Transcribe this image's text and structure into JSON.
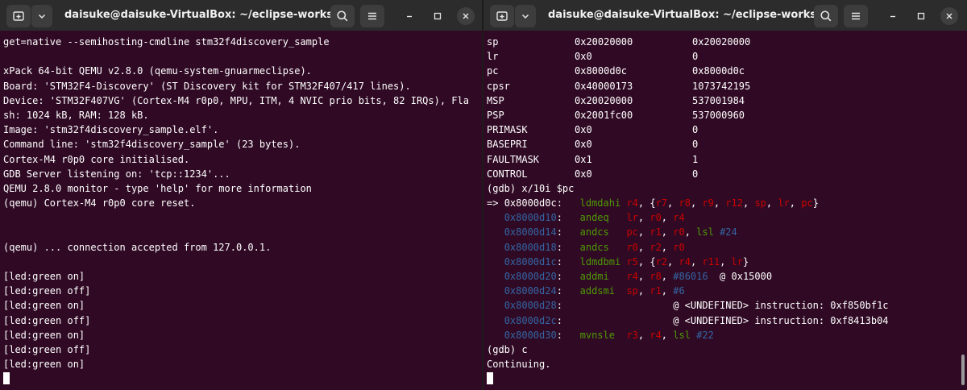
{
  "left_window": {
    "title": "daisuke@daisuke-VirtualBox: ~/eclipse-works...",
    "lines": [
      "get=native --semihosting-cmdline stm32f4discovery_sample",
      "",
      "xPack 64-bit QEMU v2.8.0 (qemu-system-gnuarmeclipse).",
      "Board: 'STM32F4-Discovery' (ST Discovery kit for STM32F407/417 lines).",
      "Device: 'STM32F407VG' (Cortex-M4 r0p0, MPU, ITM, 4 NVIC prio bits, 82 IRQs), Fla",
      "sh: 1024 kB, RAM: 128 kB.",
      "Image: 'stm32f4discovery_sample.elf'.",
      "Command line: 'stm32f4discovery_sample' (23 bytes).",
      "Cortex-M4 r0p0 core initialised.",
      "GDB Server listening on: 'tcp::1234'...",
      "QEMU 2.8.0 monitor - type 'help' for more information",
      "(qemu) Cortex-M4 r0p0 core reset.",
      "",
      "",
      "(qemu) ... connection accepted from 127.0.0.1.",
      "",
      "[led:green on]",
      "[led:green off]",
      "[led:green on]",
      "[led:green off]",
      "[led:green on]",
      "[led:green off]",
      "[led:green on]"
    ]
  },
  "right_window": {
    "title": "daisuke@daisuke-VirtualBox: ~/eclipse-works...",
    "registers": [
      {
        "name": "sp",
        "hex": "0x20020000",
        "value": "0x20020000"
      },
      {
        "name": "lr",
        "hex": "0x0",
        "value": "0"
      },
      {
        "name": "pc",
        "hex": "0x8000d0c",
        "value": "0x8000d0c"
      },
      {
        "name": "cpsr",
        "hex": "0x40000173",
        "value": "1073742195"
      },
      {
        "name": "MSP",
        "hex": "0x20020000",
        "value": "537001984"
      },
      {
        "name": "PSP",
        "hex": "0x2001fc00",
        "value": "537000960"
      },
      {
        "name": "PRIMASK",
        "hex": "0x0",
        "value": "0"
      },
      {
        "name": "BASEPRI",
        "hex": "0x0",
        "value": "0"
      },
      {
        "name": "FAULTMASK",
        "hex": "0x1",
        "value": "1"
      },
      {
        "name": "CONTROL",
        "hex": "0x0",
        "value": "0"
      }
    ],
    "gdb_command": "(gdb) x/10i $pc",
    "disasm": [
      {
        "marker": "=> ",
        "tokens": [
          [
            "cur",
            "0x8000d0c"
          ],
          [
            "cm",
            ":   "
          ],
          [
            "mn",
            "ldmdahi"
          ],
          [
            "cm",
            " "
          ],
          [
            "rg",
            "r4"
          ],
          [
            "cm",
            ", {"
          ],
          [
            "rg",
            "r7"
          ],
          [
            "cm",
            ", "
          ],
          [
            "rg",
            "r8"
          ],
          [
            "cm",
            ", "
          ],
          [
            "rg",
            "r9"
          ],
          [
            "cm",
            ", "
          ],
          [
            "rg",
            "r12"
          ],
          [
            "cm",
            ", "
          ],
          [
            "rg",
            "sp"
          ],
          [
            "cm",
            ", "
          ],
          [
            "rg",
            "lr"
          ],
          [
            "cm",
            ", "
          ],
          [
            "rg",
            "pc"
          ],
          [
            "cm",
            "}"
          ]
        ]
      },
      {
        "marker": "   ",
        "tokens": [
          [
            "addr",
            "0x8000d10"
          ],
          [
            "cm",
            ":   "
          ],
          [
            "mn",
            "andeq"
          ],
          [
            "cm",
            "   "
          ],
          [
            "rg",
            "lr"
          ],
          [
            "cm",
            ", "
          ],
          [
            "rg",
            "r0"
          ],
          [
            "cm",
            ", "
          ],
          [
            "rg",
            "r4"
          ]
        ]
      },
      {
        "marker": "   ",
        "tokens": [
          [
            "addr",
            "0x8000d14"
          ],
          [
            "cm",
            ":   "
          ],
          [
            "mn",
            "andcs"
          ],
          [
            "cm",
            "   "
          ],
          [
            "rg",
            "pc"
          ],
          [
            "cm",
            ", "
          ],
          [
            "rg",
            "r1"
          ],
          [
            "cm",
            ", "
          ],
          [
            "rg",
            "r0"
          ],
          [
            "cm",
            ", "
          ],
          [
            "mn",
            "lsl"
          ],
          [
            "cm",
            " "
          ],
          [
            "im",
            "#24"
          ]
        ]
      },
      {
        "marker": "   ",
        "tokens": [
          [
            "addr",
            "0x8000d18"
          ],
          [
            "cm",
            ":   "
          ],
          [
            "mn",
            "andcs"
          ],
          [
            "cm",
            "   "
          ],
          [
            "rg",
            "r0"
          ],
          [
            "cm",
            ", "
          ],
          [
            "rg",
            "r2"
          ],
          [
            "cm",
            ", "
          ],
          [
            "rg",
            "r0"
          ]
        ]
      },
      {
        "marker": "   ",
        "tokens": [
          [
            "addr",
            "0x8000d1c"
          ],
          [
            "cm",
            ":   "
          ],
          [
            "mn",
            "ldmdbmi"
          ],
          [
            "cm",
            " "
          ],
          [
            "rg",
            "r5"
          ],
          [
            "cm",
            ", {"
          ],
          [
            "rg",
            "r2"
          ],
          [
            "cm",
            ", "
          ],
          [
            "rg",
            "r4"
          ],
          [
            "cm",
            ", "
          ],
          [
            "rg",
            "r11"
          ],
          [
            "cm",
            ", "
          ],
          [
            "rg",
            "lr"
          ],
          [
            "cm",
            "}"
          ]
        ]
      },
      {
        "marker": "   ",
        "tokens": [
          [
            "addr",
            "0x8000d20"
          ],
          [
            "cm",
            ":   "
          ],
          [
            "mn",
            "addmi"
          ],
          [
            "cm",
            "   "
          ],
          [
            "rg",
            "r4"
          ],
          [
            "cm",
            ", "
          ],
          [
            "rg",
            "r8"
          ],
          [
            "cm",
            ", "
          ],
          [
            "im",
            "#86016"
          ],
          [
            "cm",
            "  @ 0x15000"
          ]
        ]
      },
      {
        "marker": "   ",
        "tokens": [
          [
            "addr",
            "0x8000d24"
          ],
          [
            "cm",
            ":   "
          ],
          [
            "mn",
            "addsmi"
          ],
          [
            "cm",
            "  "
          ],
          [
            "rg",
            "sp"
          ],
          [
            "cm",
            ", "
          ],
          [
            "rg",
            "r1"
          ],
          [
            "cm",
            ", "
          ],
          [
            "im",
            "#6"
          ]
        ]
      },
      {
        "marker": "   ",
        "tokens": [
          [
            "addr",
            "0x8000d28"
          ],
          [
            "cm",
            ":                   @ <UNDEFINED> instruction: 0xf850bf1c"
          ]
        ]
      },
      {
        "marker": "   ",
        "tokens": [
          [
            "addr",
            "0x8000d2c"
          ],
          [
            "cm",
            ":                   @ <UNDEFINED> instruction: 0xf8413b04"
          ]
        ]
      },
      {
        "marker": "   ",
        "tokens": [
          [
            "addr",
            "0x8000d30"
          ],
          [
            "cm",
            ":   "
          ],
          [
            "mn",
            "mvnsle"
          ],
          [
            "cm",
            "  "
          ],
          [
            "rg",
            "r3"
          ],
          [
            "cm",
            ", "
          ],
          [
            "rg",
            "r4"
          ],
          [
            "cm",
            ", "
          ],
          [
            "mn",
            "lsl"
          ],
          [
            "cm",
            " "
          ],
          [
            "im",
            "#22"
          ]
        ]
      }
    ],
    "after_lines": [
      "(gdb) c",
      "Continuing."
    ]
  },
  "colors": {
    "terminal_bg": "#300a24",
    "titlebar_bg": "#2c2c2c",
    "address": "#3465a4",
    "mnemonic": "#4e9a06",
    "register": "#cc0000"
  },
  "icons": [
    "new-tab-icon",
    "chevron-down-icon",
    "search-icon",
    "hamburger-menu-icon",
    "minimize-icon",
    "maximize-icon",
    "close-icon"
  ]
}
